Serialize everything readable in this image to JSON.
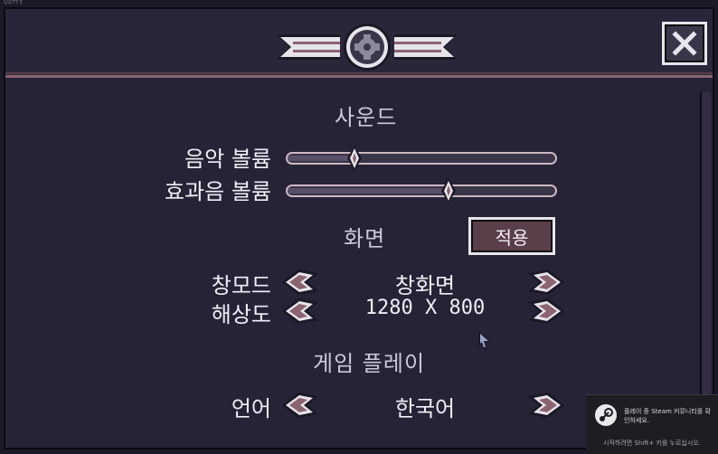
{
  "window": {
    "corner_text": "1/2/77 5"
  },
  "header": {
    "emblem_icon": "gear-emblem-icon",
    "close_label": "X"
  },
  "sections": {
    "sound": "사운드",
    "screen": "화면",
    "gameplay": "게임 플레이"
  },
  "sound": {
    "music_label": "음악 볼륨",
    "music_level": 0.25,
    "sfx_label": "효과음 볼륨",
    "sfx_level": 0.6
  },
  "screen": {
    "apply_label": "적용",
    "window_mode_label": "창모드",
    "window_mode_value": "창화면",
    "resolution_label": "해상도",
    "resolution_value": "1280 X 800"
  },
  "gameplay": {
    "language_label": "언어",
    "language_value": "한국어"
  },
  "steam_toast": {
    "icon": "steam-icon",
    "message": "플레이 중 Steam 커뮤니티를 확인하세요.",
    "footer": "시작하려면 Shift+ 키를 누르십시오."
  },
  "colors": {
    "background": "#262336",
    "accent": "#8a6470",
    "text": "#f2eef6"
  }
}
